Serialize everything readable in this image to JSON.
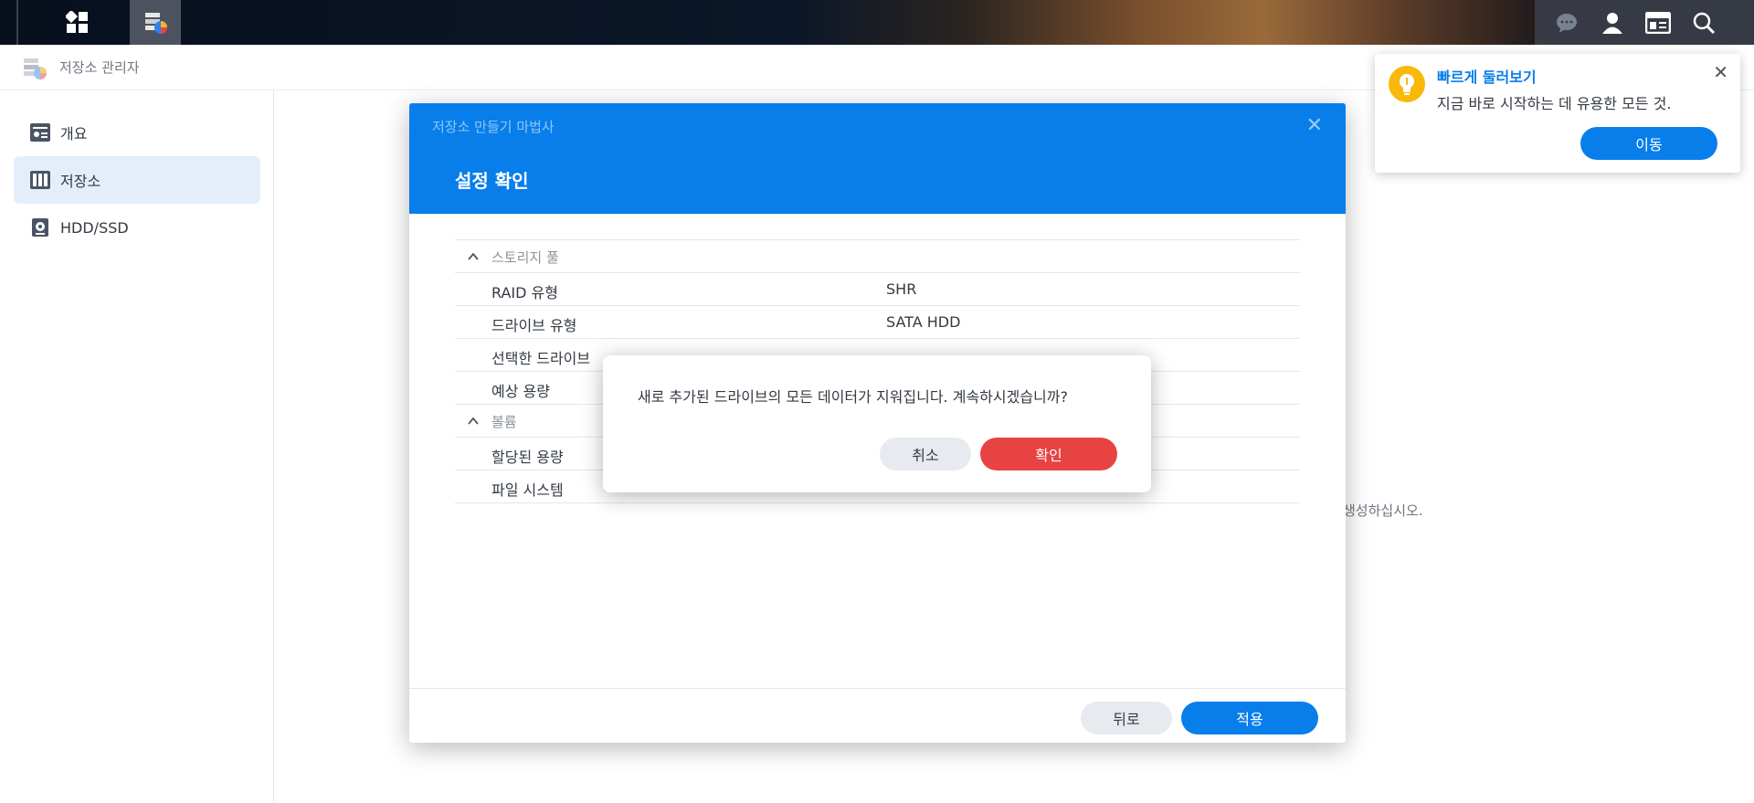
{
  "app": {
    "title": "저장소 관리자"
  },
  "sidebar": {
    "items": [
      {
        "label": "개요",
        "icon": "overview-icon"
      },
      {
        "label": "저장소",
        "icon": "storage-icon",
        "active": true
      },
      {
        "label": "HDD/SSD",
        "icon": "hdd-icon"
      }
    ]
  },
  "background": {
    "hint_text": "생성하십시오."
  },
  "wizard": {
    "window_title": "저장소 만들기 마법사",
    "heading": "설정 확인",
    "sections": [
      {
        "title": "스토리지 풀",
        "rows": [
          {
            "key": "RAID 유형",
            "value": "SHR"
          },
          {
            "key": "드라이브 유형",
            "value": "SATA HDD"
          },
          {
            "key": "선택한 드라이브",
            "value": ""
          },
          {
            "key": "예상 용량",
            "value": ""
          }
        ]
      },
      {
        "title": "볼륨",
        "rows": [
          {
            "key": "할당된 용량",
            "value": ""
          },
          {
            "key": "파일 시스템",
            "value": ""
          }
        ]
      }
    ],
    "back_label": "뒤로",
    "apply_label": "적용"
  },
  "confirm": {
    "message": "새로 추가된 드라이브의 모든 데이터가 지워집니다. 계속하시겠습니까?",
    "cancel_label": "취소",
    "ok_label": "확인"
  },
  "toast": {
    "title": "빠르게 둘러보기",
    "message": "지금 바로 시작하는 데 유용한 모든 것.",
    "button_label": "이동"
  },
  "colors": {
    "accent": "#087eea",
    "danger": "#e84343",
    "bulb": "#f8b90a"
  }
}
